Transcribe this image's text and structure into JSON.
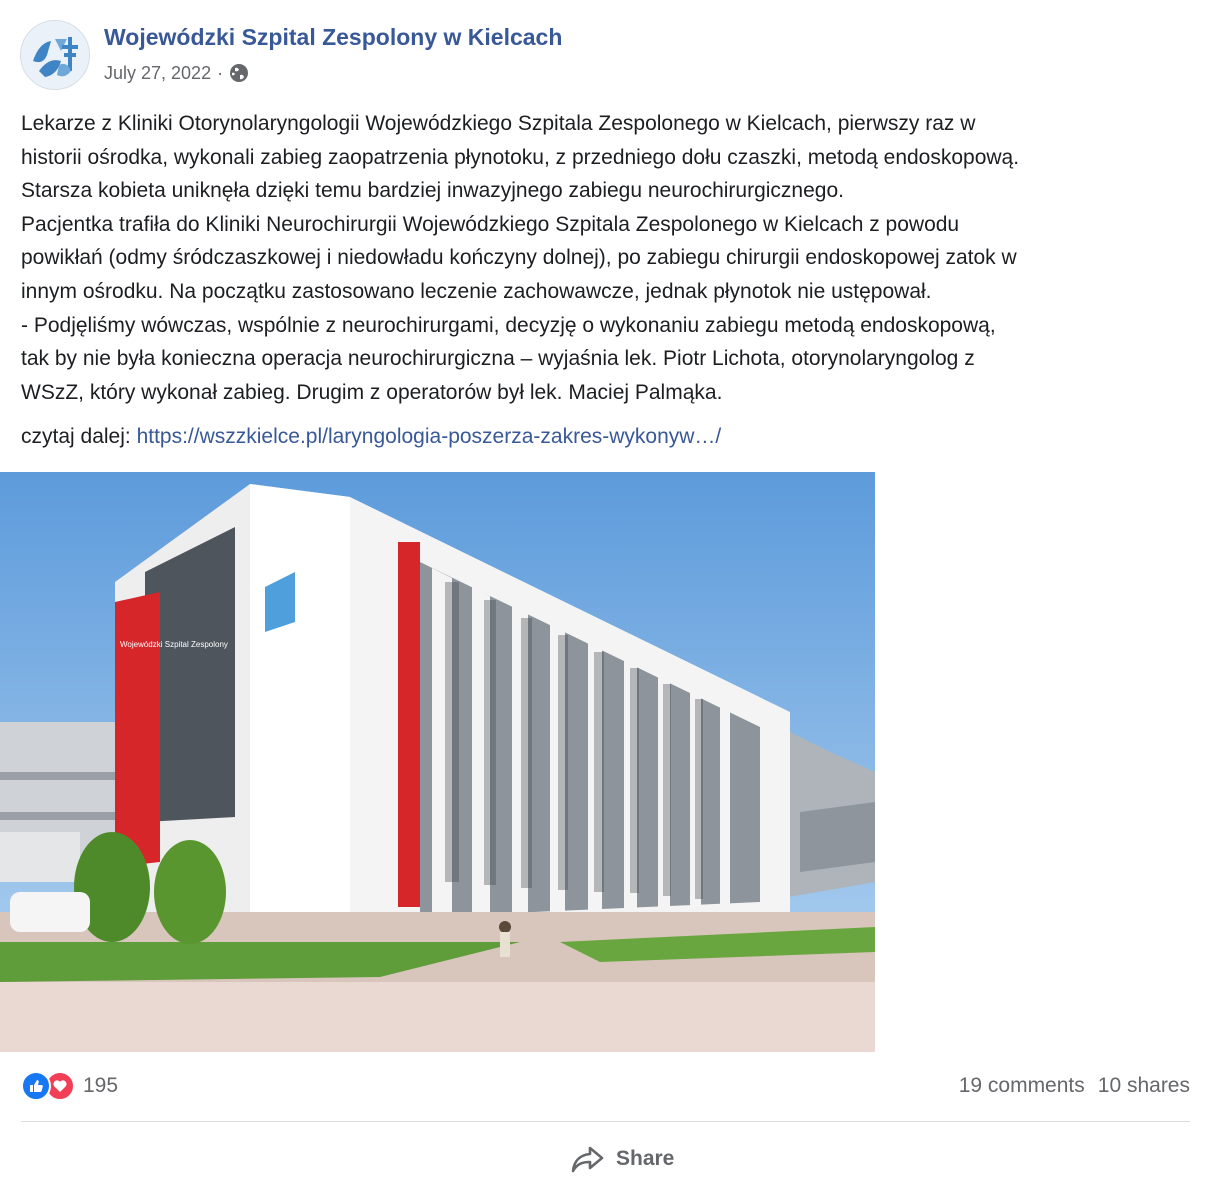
{
  "post": {
    "page_name": "Wojewódzki Szpital Zespolony w Kielcach",
    "date": "July 27, 2022",
    "separator": "·",
    "privacy_icon": "globe-icon",
    "text_lines": [
      "Lekarze z Kliniki Otorynolaryngologii Wojewódzkiego Szpitala Zespolonego w Kielcach, pierwszy raz w",
      "historii ośrodka, wykonali zabieg zaopatrzenia płynotoku, z przedniego dołu czaszki, metodą endoskopową.",
      "Starsza kobieta uniknęła dzięki temu bardziej inwazyjnego zabiegu neurochirurgicznego.",
      "Pacjentka trafiła do Kliniki Neurochirurgii Wojewódzkiego Szpitala Zespolonego w Kielcach z powodu",
      "powikłań (odmy śródczaszkowej i niedowładu kończyny dolnej), po zabiegu chirurgii endoskopowej zatok w",
      "innym ośrodku. Na początku zastosowano leczenie zachowawcze, jednak płynotok nie ustępował.",
      "- Podjęliśmy wówczas, wspólnie z neurochirurgami, decyzję o wykonaniu zabiegu metodą endoskopową,",
      "tak by nie była konieczna operacja neurochirurgiczna – wyjaśnia lek. Piotr Lichota, otorynolaryngolog z",
      "WSzZ, który wykonał zabieg. Drugim z operatorów był lek. Maciej Palmąka."
    ],
    "read_more_label": "czytaj dalej:",
    "read_more_link": "https://wszzkielce.pl/laryngologia-poszerza-zakres-wykonyw…/",
    "photo_sign_text": "Wojewódzki Szpital Zespolony"
  },
  "engagement": {
    "reaction_icons": [
      "like-icon",
      "love-icon"
    ],
    "reaction_count": "195",
    "comments": "19 comments",
    "shares": "10 shares",
    "share_button_label": "Share",
    "share_icon": "share-arrow-icon"
  },
  "colors": {
    "link": "#385898",
    "secondary_text": "#65676b",
    "like": "#1877f2",
    "love": "#f33e58"
  }
}
